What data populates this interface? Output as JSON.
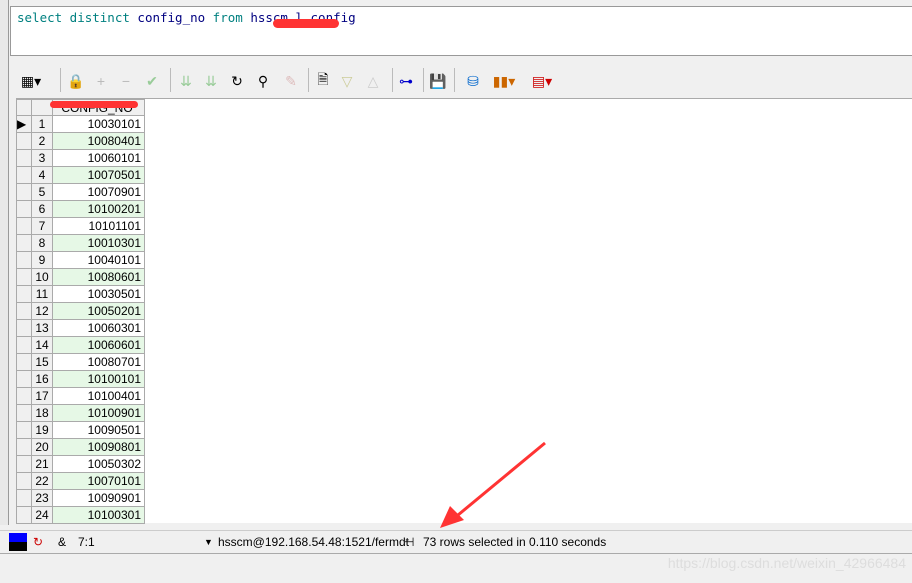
{
  "sql": {
    "kw1": "select distinct ",
    "col": "config_no",
    "kw2": " from ",
    "table_tail": "l_config",
    "table_prefix": "hsscm_"
  },
  "toolbar": {
    "icons": [
      "grid-options-icon",
      "lock-icon",
      "add-record-icon",
      "delete-record-icon",
      "post-changes-icon",
      "fetch-next-icon",
      "fetch-last-icon",
      "refresh-icon",
      "find-icon",
      "clear-icon",
      "query-by-example-icon",
      "sort-desc-icon",
      "sort-asc-icon",
      "tree-view-icon",
      "save-icon",
      "export-icon",
      "chart-icon",
      "grid-table-icon"
    ]
  },
  "grid": {
    "column": "CONFIG_NO",
    "rows": [
      "10030101",
      "10080401",
      "10060101",
      "10070501",
      "10070901",
      "10100201",
      "10101101",
      "10010301",
      "10040101",
      "10080601",
      "10030501",
      "10050201",
      "10060301",
      "10060601",
      "10080701",
      "10100101",
      "10100401",
      "10100901",
      "10090501",
      "10090801",
      "10050302",
      "10070101",
      "10090901",
      "10100301"
    ]
  },
  "status": {
    "position": "7:1",
    "connection": "hsscm@192.168.54.48:1521/fermdt",
    "message": "73 rows selected in 0.110 seconds",
    "watermark": "https://blog.csdn.net/weixin_42966484"
  }
}
